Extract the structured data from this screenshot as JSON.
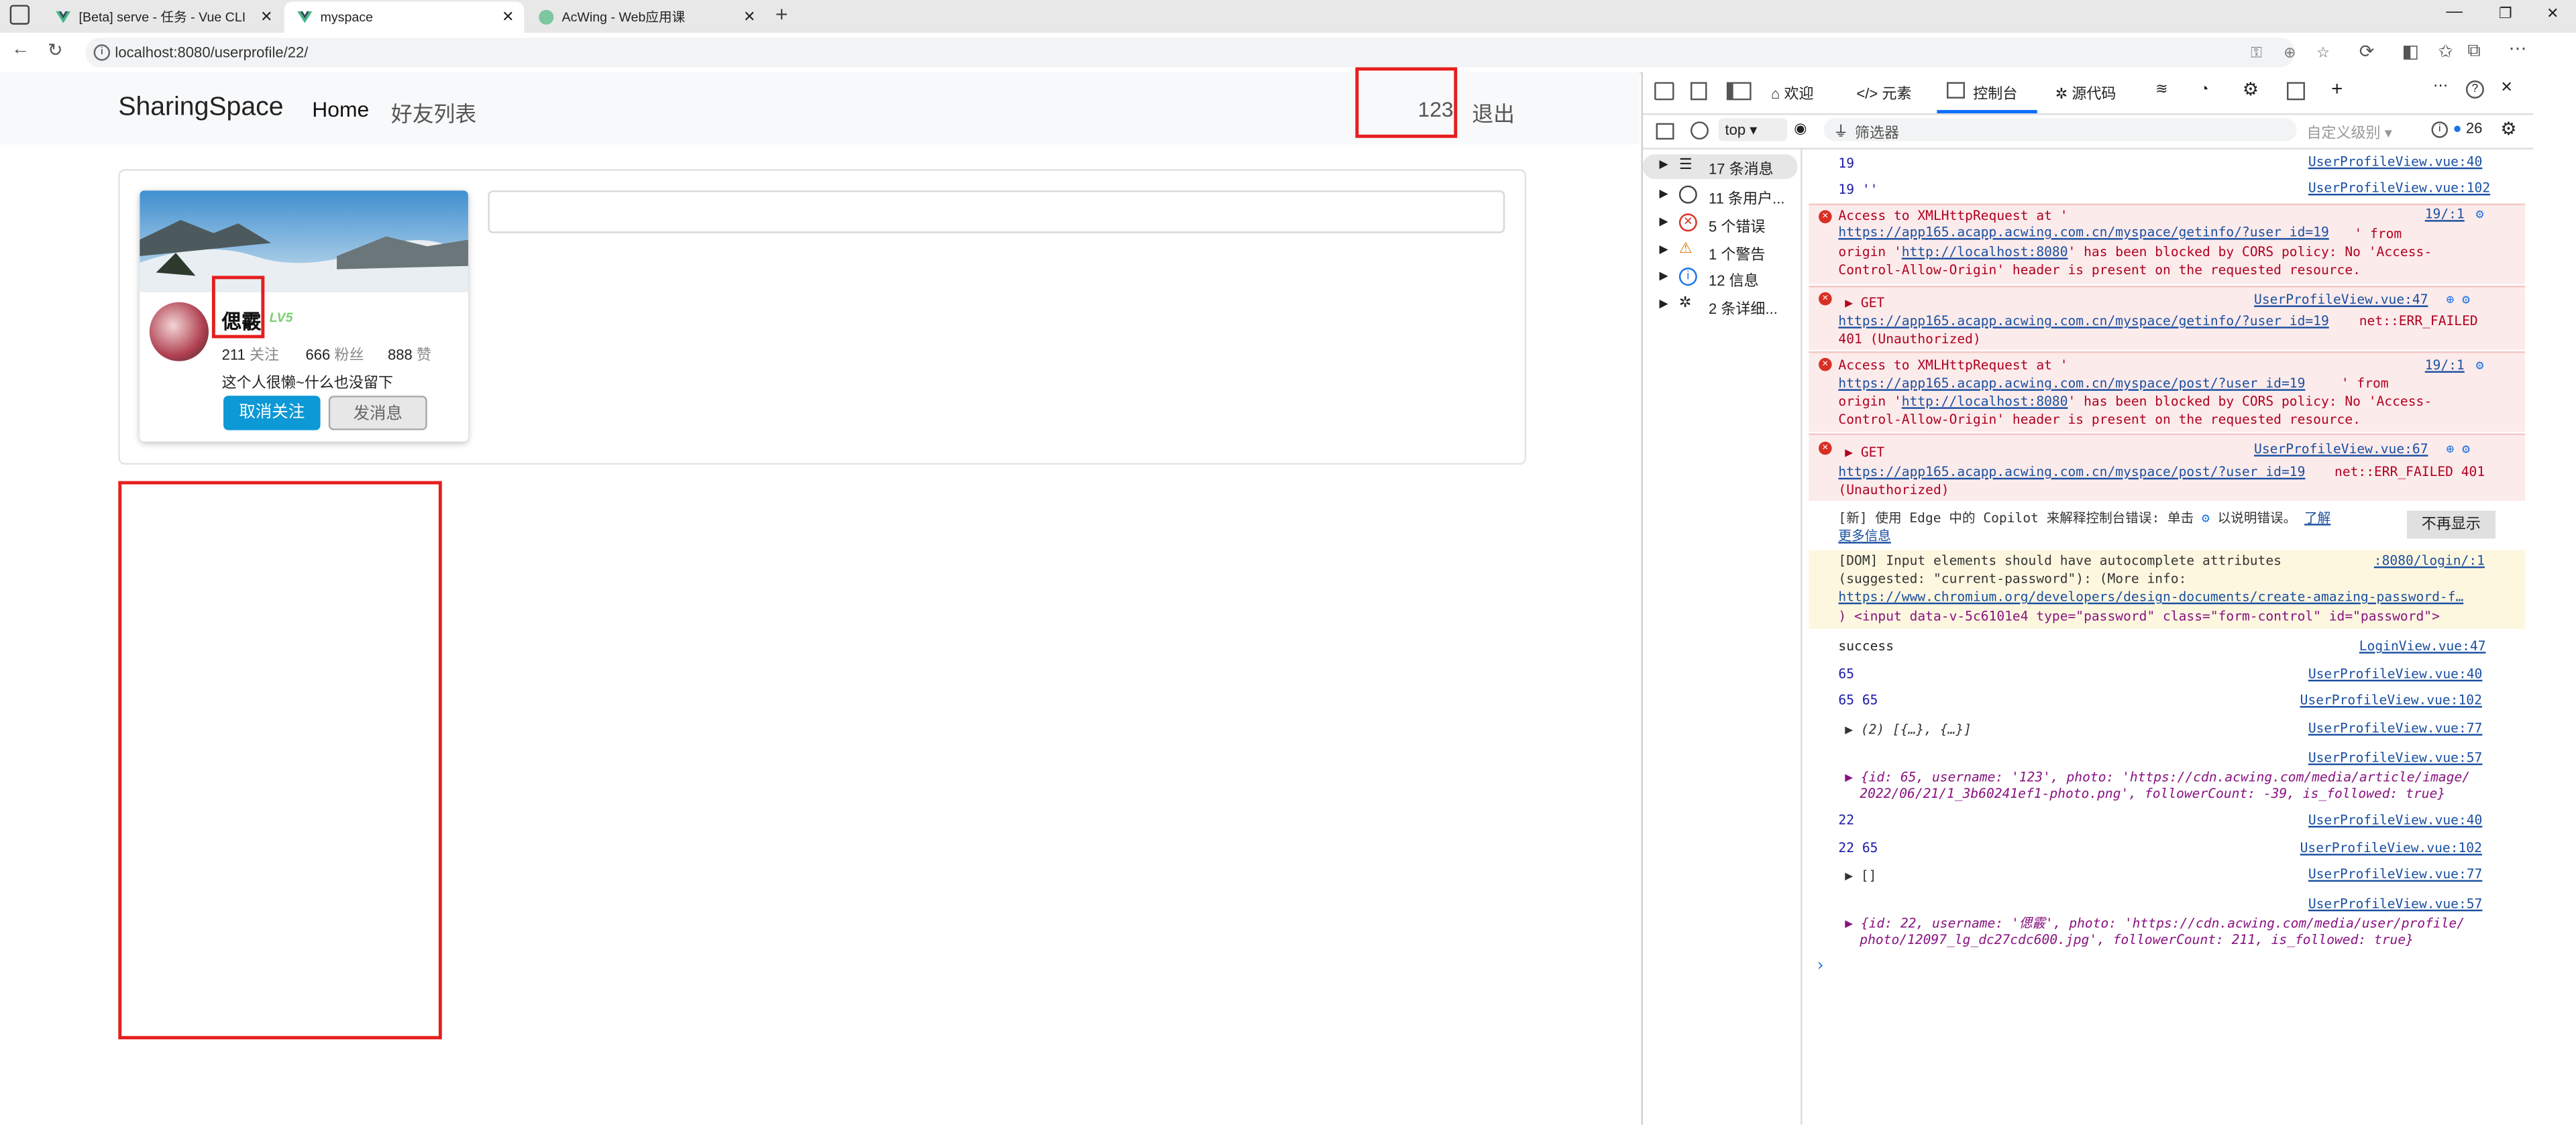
{
  "browser": {
    "tabs": [
      {
        "title": "[Beta] serve - 任务 - Vue CLI"
      },
      {
        "title": "myspace"
      },
      {
        "title": "AcWing - Web应用课"
      }
    ],
    "url": "localhost:8080/userprofile/22/"
  },
  "nav": {
    "brand": "SharingSpace",
    "home": "Home",
    "friends": "好友列表",
    "username": "123",
    "logout": "退出"
  },
  "profile": {
    "name": "偲霰",
    "level": "LV5",
    "following_count": "211",
    "following_label": "关注",
    "fans_count": "666",
    "fans_label": "粉丝",
    "likes_count": "888",
    "likes_label": "赞",
    "bio": "这个人很懒~什么也没留下",
    "unfollow_btn": "取消关注",
    "message_btn": "发消息"
  },
  "devtools": {
    "tabs": [
      "欢迎",
      "元素",
      "控制台",
      "源代码"
    ],
    "context": "top",
    "filter_placeholder": "筛选器",
    "level_select": "自定义级别",
    "issue_count": "26",
    "sidebar": [
      {
        "label": "17 条消息"
      },
      {
        "label": "11 条用户..."
      },
      {
        "label": "5 个错误"
      },
      {
        "label": "1 个警告"
      },
      {
        "label": "12 信息"
      },
      {
        "label": "2 条详细..."
      }
    ],
    "log": {
      "l1_msg": "19",
      "l1_src": "UserProfileView.vue:40",
      "l2_msg": "19 ''",
      "l2_src": "UserProfileView.vue:102",
      "e1_a": "Access to XMLHttpRequest at '",
      "e1_url": "https://app165.acapp.acwing.com.cn/myspace/getinfo/?user_id=19",
      "e1_from": "' from",
      "e1_b": "origin '",
      "e1_origin": "http://localhost:8080",
      "e1_c": "' has been blocked by CORS policy: No 'Access-",
      "e1_d": "Control-Allow-Origin' header is present on the requested resource.",
      "e1_src": "19/:1",
      "e2_get": "GET",
      "e2_src": "UserProfileView.vue:47",
      "e2_url": "https://app165.acapp.acwing.com.cn/myspace/getinfo/?user_id=19",
      "e2_err": "net::ERR_FAILED",
      "e2_b": "401 (Unauthorized)",
      "e3_a": "Access to XMLHttpRequest at '",
      "e3_url": "https://app165.acapp.acwing.com.cn/myspace/post/?user_id=19",
      "e3_from": "' from",
      "e3_b": "origin '",
      "e3_origin": "http://localhost:8080",
      "e3_c": "' has been blocked by CORS policy: No 'Access-",
      "e3_d": "Control-Allow-Origin' header is present on the requested resource.",
      "e3_src": "19/:1",
      "e4_get": "GET",
      "e4_src": "UserProfileView.vue:67",
      "e4_url": "https://app165.acapp.acwing.com.cn/myspace/post/?user_id=19",
      "e4_err": "net::ERR_FAILED 401",
      "e4_b": "(Unauthorized)",
      "copilot_a": "[新] 使用 Edge 中的 Copilot 来解释控制台错误: 单击",
      "copilot_b": "以说明错误。",
      "copilot_link": "了解",
      "copilot_link2": "更多信息",
      "copilot_btn": "不再显示",
      "w1_a": "[DOM] Input elements should have autocomplete attributes",
      "w1_b": "(suggested: \"current-password\"): (More info:",
      "w1_url": "https://www.chromium.org/developers/design-documents/create-amazing-password-f…",
      "w1_c": ")   <input data-v-5c6101e4 type=\"password\" class=\"form-control\" id=\"password\">",
      "w1_src": ":8080/login/:1",
      "l3_msg": "success",
      "l3_src": "LoginView.vue:47",
      "l4_msg": "65",
      "l4_src": "UserProfileView.vue:40",
      "l5_msg": "65 65",
      "l5_src": "UserProfileView.vue:102",
      "l6_msg": "(2) [{…}, {…}]",
      "l6_src": "UserProfileView.vue:77",
      "l7_src": "UserProfileView.vue:57",
      "l7_a": "{id: 65, username: '123', photo: 'https://cdn.acwing.com/media/article/image/",
      "l7_b": "2022/06/21/1_3b60241ef1-photo.png', followerCount: -39, is_followed: true}",
      "l8_msg": "22",
      "l8_src": "UserProfileView.vue:40",
      "l9_msg": "22 65",
      "l9_src": "UserProfileView.vue:102",
      "l10_msg": "[]",
      "l10_src": "UserProfileView.vue:77",
      "l11_src": "UserProfileView.vue:57",
      "l11_a": "{id: 22, username: '偲霰', photo: 'https://cdn.acwing.com/media/user/profile/",
      "l11_b": "photo/12097_lg_dc27cdc600.jpg', followerCount: 211, is_followed: true}"
    }
  },
  "colors": {
    "accent": "#0d98d6",
    "error_bg": "#fcebeb",
    "warning_bg": "#fef7e0",
    "annotation_red": "#e61e1e",
    "link": "#1a4fa0"
  }
}
